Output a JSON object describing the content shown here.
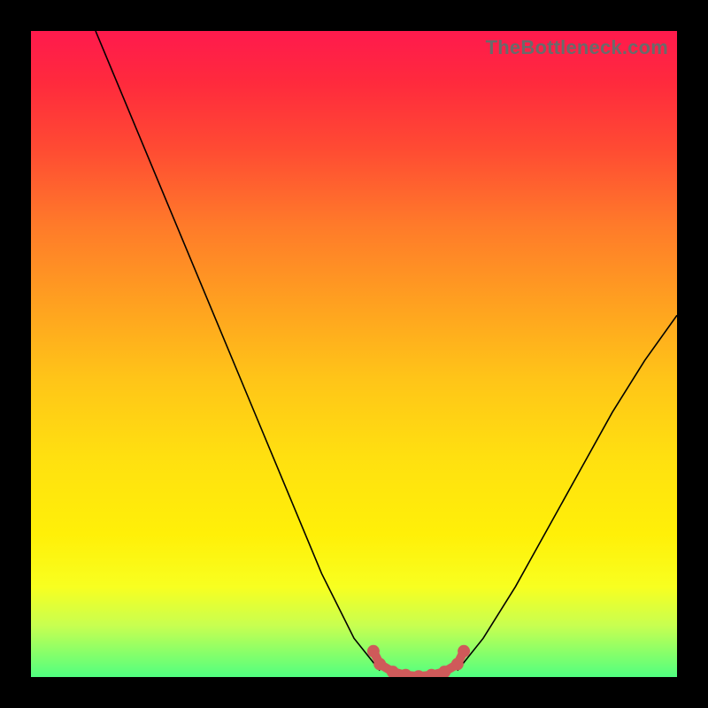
{
  "watermark": "TheBottleneck.com",
  "chart_data": {
    "type": "line",
    "title": "",
    "xlabel": "",
    "ylabel": "",
    "xlim": [
      0,
      100
    ],
    "ylim": [
      0,
      100
    ],
    "grid": false,
    "legend": false,
    "series": [
      {
        "name": "left-curve",
        "x": [
          10,
          15,
          20,
          25,
          30,
          35,
          40,
          45,
          50,
          54
        ],
        "values": [
          100,
          88,
          76,
          64,
          52,
          40,
          28,
          16,
          6,
          1
        ]
      },
      {
        "name": "right-curve",
        "x": [
          66,
          70,
          75,
          80,
          85,
          90,
          95,
          100
        ],
        "values": [
          1,
          6,
          14,
          23,
          32,
          41,
          49,
          56
        ]
      },
      {
        "name": "valley-highlight",
        "x": [
          53,
          54,
          56,
          58,
          60,
          62,
          64,
          66,
          67
        ],
        "values": [
          4,
          2,
          0.8,
          0.3,
          0.1,
          0.3,
          0.8,
          2,
          4
        ]
      }
    ],
    "colors": {
      "curve": "#000000",
      "valley": "#cf5a5a",
      "gradient_top": "#ff1a4d",
      "gradient_bottom": "#50ff80"
    }
  }
}
